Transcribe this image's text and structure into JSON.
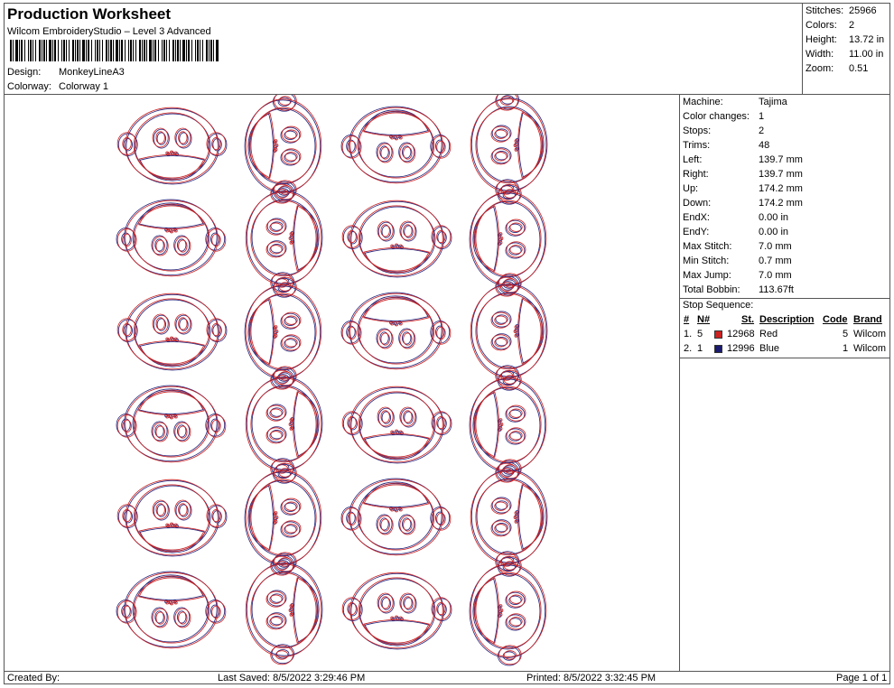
{
  "header": {
    "title": "Production Worksheet",
    "subtitle": "Wilcom EmbroideryStudio – Level 3 Advanced",
    "design_label": "Design:",
    "design_value": "MonkeyLineA3",
    "colorway_label": "Colorway:",
    "colorway_value": "Colorway 1"
  },
  "stats": [
    {
      "label": "Stitches:",
      "value": "25966"
    },
    {
      "label": "Colors:",
      "value": "2"
    },
    {
      "label": "Height:",
      "value": "13.72 in"
    },
    {
      "label": "Width:",
      "value": "11.00 in"
    },
    {
      "label": "Zoom:",
      "value": "0.51"
    }
  ],
  "machine_info": [
    {
      "label": "Machine:",
      "value": "Tajima"
    },
    {
      "label": "Color changes:",
      "value": "1"
    },
    {
      "label": "Stops:",
      "value": "2"
    },
    {
      "label": "Trims:",
      "value": "48"
    },
    {
      "label": "Left:",
      "value": "139.7 mm"
    },
    {
      "label": "Right:",
      "value": "139.7 mm"
    },
    {
      "label": "Up:",
      "value": "174.2 mm"
    },
    {
      "label": "Down:",
      "value": "174.2 mm"
    },
    {
      "label": "EndX:",
      "value": "0.00 in"
    },
    {
      "label": "EndY:",
      "value": "0.00 in"
    },
    {
      "label": "Max Stitch:",
      "value": "7.0 mm"
    },
    {
      "label": "Min Stitch:",
      "value": "0.7 mm"
    },
    {
      "label": "Max Jump:",
      "value": "7.0 mm"
    },
    {
      "label": "Total Bobbin:",
      "value": "113.67ft"
    }
  ],
  "stop_sequence": {
    "title": "Stop Sequence:",
    "headers": {
      "num": "#",
      "n": "N#",
      "st": "St.",
      "description": "Description",
      "code": "Code",
      "brand": "Brand"
    },
    "rows": [
      {
        "num": "1.",
        "n": "5",
        "color": "#cc2222",
        "st": "12968",
        "description": "Red",
        "code": "5",
        "brand": "Wilcom"
      },
      {
        "num": "2.",
        "n": "1",
        "color": "#1a1a6e",
        "st": "12996",
        "description": "Blue",
        "code": "1",
        "brand": "Wilcom"
      }
    ]
  },
  "footer": {
    "created": "Created By:",
    "saved": "Last Saved: 8/5/2022 3:29:46 PM",
    "printed": "Printed: 8/5/2022 3:32:45 PM",
    "page": "Page 1 of 1"
  },
  "design_preview": {
    "rows": 6,
    "cols": 4,
    "stitch_colors": {
      "red": "#cc2222",
      "blue": "#2a2a80"
    }
  }
}
